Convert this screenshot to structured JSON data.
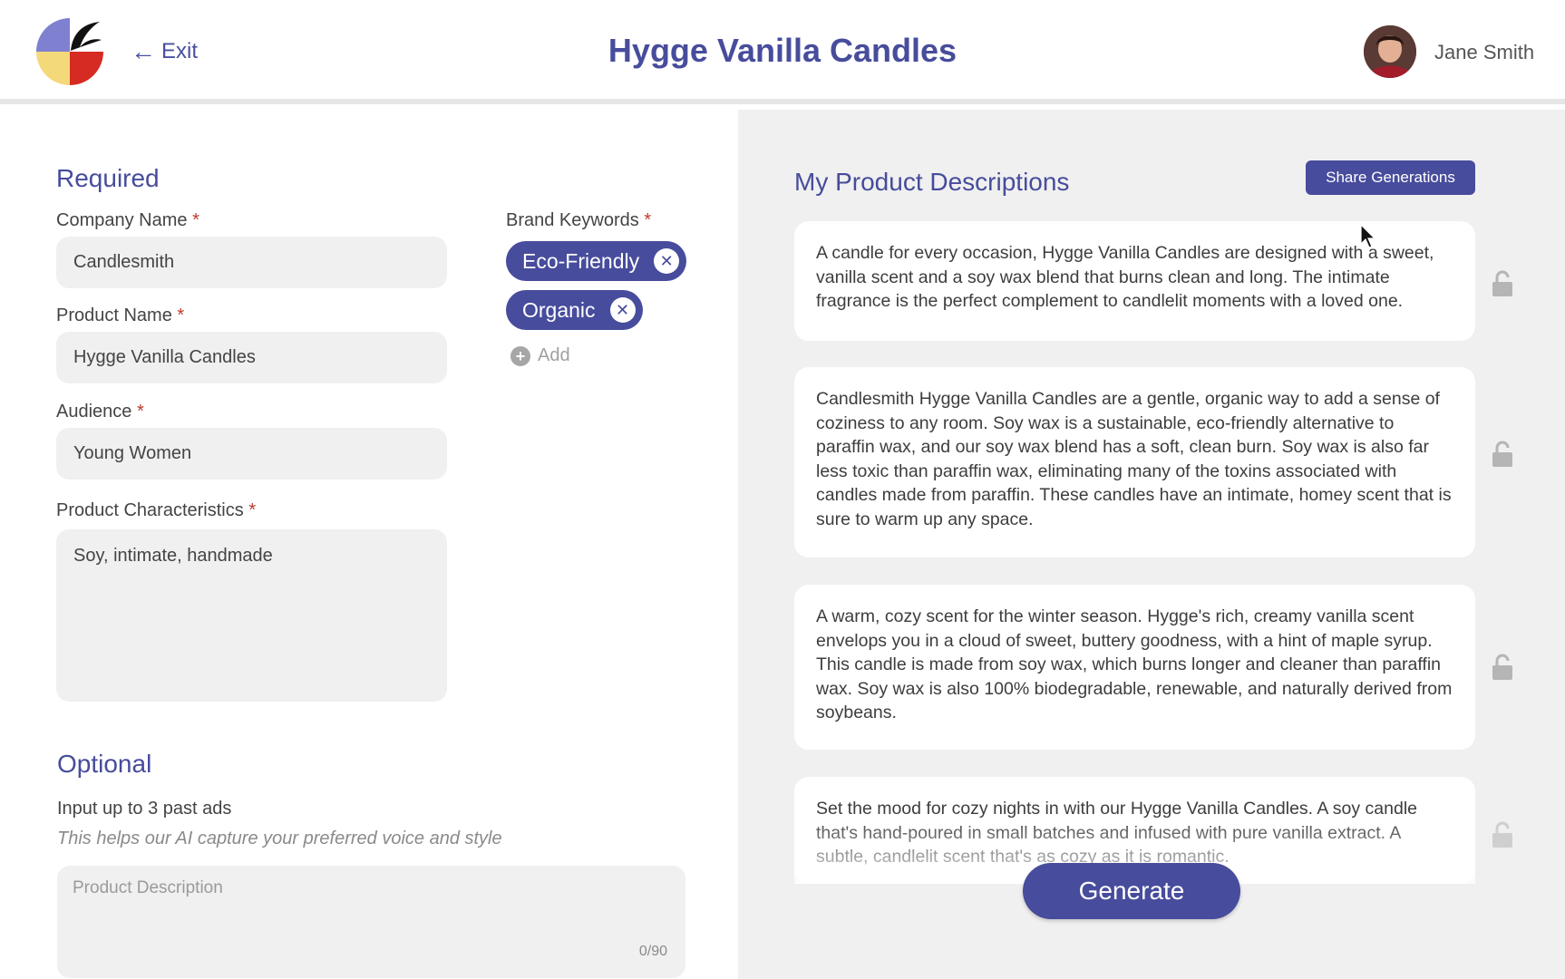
{
  "header": {
    "exit_label": "Exit",
    "title": "Hygge Vanilla Candles",
    "user_name": "Jane Smith"
  },
  "required": {
    "section_title": "Required",
    "company_name": {
      "label": "Company Name",
      "value": "Candlesmith"
    },
    "product_name": {
      "label": "Product Name",
      "value": "Hygge Vanilla Candles"
    },
    "audience": {
      "label": "Audience",
      "value": "Young Women"
    },
    "product_characteristics": {
      "label": "Product Characteristics",
      "value": "Soy, intimate, handmade"
    },
    "brand_keywords": {
      "label": "Brand Keywords",
      "chips": [
        "Eco-Friendly",
        "Organic"
      ],
      "add_label": "Add"
    },
    "required_marker": "*"
  },
  "optional": {
    "section_title": "Optional",
    "subtitle": "Input up to 3 past ads",
    "hint": "This helps our AI capture your preferred voice and style",
    "description_placeholder": "Product Description",
    "char_count": "0/90"
  },
  "descriptions": {
    "title": "My Product Descriptions",
    "share_label": "Share Generations",
    "items": [
      "A candle for every occasion, Hygge Vanilla Candles are designed with a sweet, vanilla scent and a soy wax blend that burns clean and long. The intimate fragrance is the perfect complement to candlelit moments with a loved one.",
      "Candlesmith Hygge Vanilla Candles are a gentle, organic way to add a sense of coziness to any room. Soy wax is a sustainable, eco-friendly alternative to paraffin wax, and our soy wax blend has a soft, clean burn. Soy wax is also far less toxic than paraffin wax, eliminating many of the toxins associated with candles made from paraffin. These candles have an intimate, homey scent that is sure to warm up any space.",
      "A warm, cozy scent for the winter season. Hygge's rich, creamy vanilla scent envelops you in a cloud of sweet, buttery goodness, with a hint of maple syrup. This candle is made from soy wax, which burns longer and cleaner than paraffin wax. Soy wax is also 100% biodegradable, renewable, and naturally derived from soybeans.",
      "Set the mood for cozy nights in with our Hygge Vanilla Candles. A soy candle that's hand-poured in small batches and infused with pure vanilla extract. A subtle, candlelit scent that's as cozy as it is romantic."
    ],
    "generate_label": "Generate"
  },
  "colors": {
    "accent": "#474c9c",
    "required_marker": "#c0392b",
    "panel_bg": "#f0f0f0"
  }
}
